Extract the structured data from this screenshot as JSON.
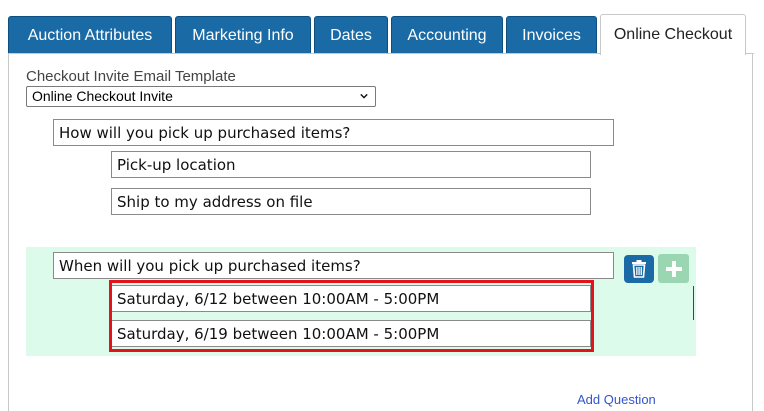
{
  "tabs": [
    {
      "label": "Auction Attributes",
      "active": false
    },
    {
      "label": "Marketing Info",
      "active": false
    },
    {
      "label": "Dates",
      "active": false
    },
    {
      "label": "Accounting",
      "active": false
    },
    {
      "label": "Invoices",
      "active": false
    },
    {
      "label": "Online Checkout",
      "active": true
    }
  ],
  "template": {
    "label": "Checkout Invite Email Template",
    "selected": "Online Checkout Invite"
  },
  "question1": {
    "text": "How will you pick up purchased items?",
    "options": [
      "Pick-up location",
      "Ship to my address on file"
    ]
  },
  "question2": {
    "text": "When will you pick up purchased items?",
    "options": [
      "Saturday, 6/12 between 10:00AM - 5:00PM",
      "Saturday, 6/19 between 10:00AM - 5:00PM"
    ]
  },
  "actions": {
    "add_question": "Add Question"
  },
  "colors": {
    "tab_blue": "#1a6aa6",
    "highlight_red": "#e3131c",
    "question_bg": "#dcfbea",
    "add_green": "#9bd6b3"
  },
  "icons": {
    "delete": "trash-icon",
    "add": "plus-icon",
    "dropdown": "chevron-down-icon"
  }
}
